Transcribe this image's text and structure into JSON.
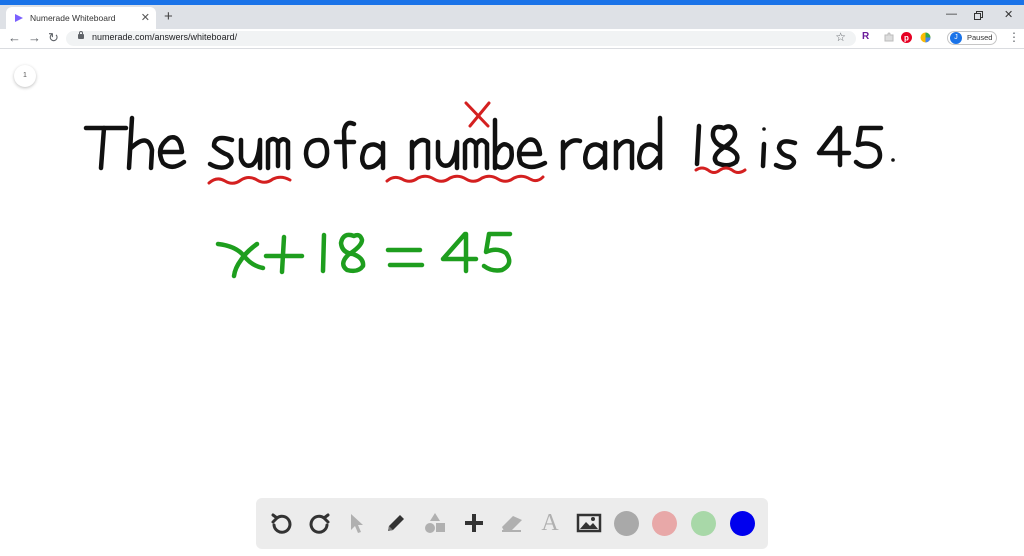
{
  "browser": {
    "tab_title": "Numerade Whiteboard",
    "url": "numerade.com/answers/whiteboard/",
    "profile_initial": "J",
    "profile_status": "Paused",
    "extension_r": "R"
  },
  "whiteboard": {
    "page_number": "1",
    "sentence_words": [
      "The",
      "sum",
      "of",
      "a",
      "number",
      "and",
      "18",
      "is",
      "45."
    ],
    "annotation": "x",
    "equation": "x+18=45",
    "ink_colors": {
      "black": "#111111",
      "red": "#d42020",
      "green": "#1e9e1e"
    }
  },
  "toolbar": {
    "tools": [
      "undo-icon",
      "redo-icon",
      "pointer-icon",
      "pen-icon",
      "shapes-icon",
      "plus-icon",
      "eraser-icon",
      "text-icon",
      "image-icon"
    ],
    "text_tool_label": "A",
    "colors": [
      "#a9a9a9",
      "#e8a8a8",
      "#a8d8a8",
      "#0000ee"
    ]
  }
}
